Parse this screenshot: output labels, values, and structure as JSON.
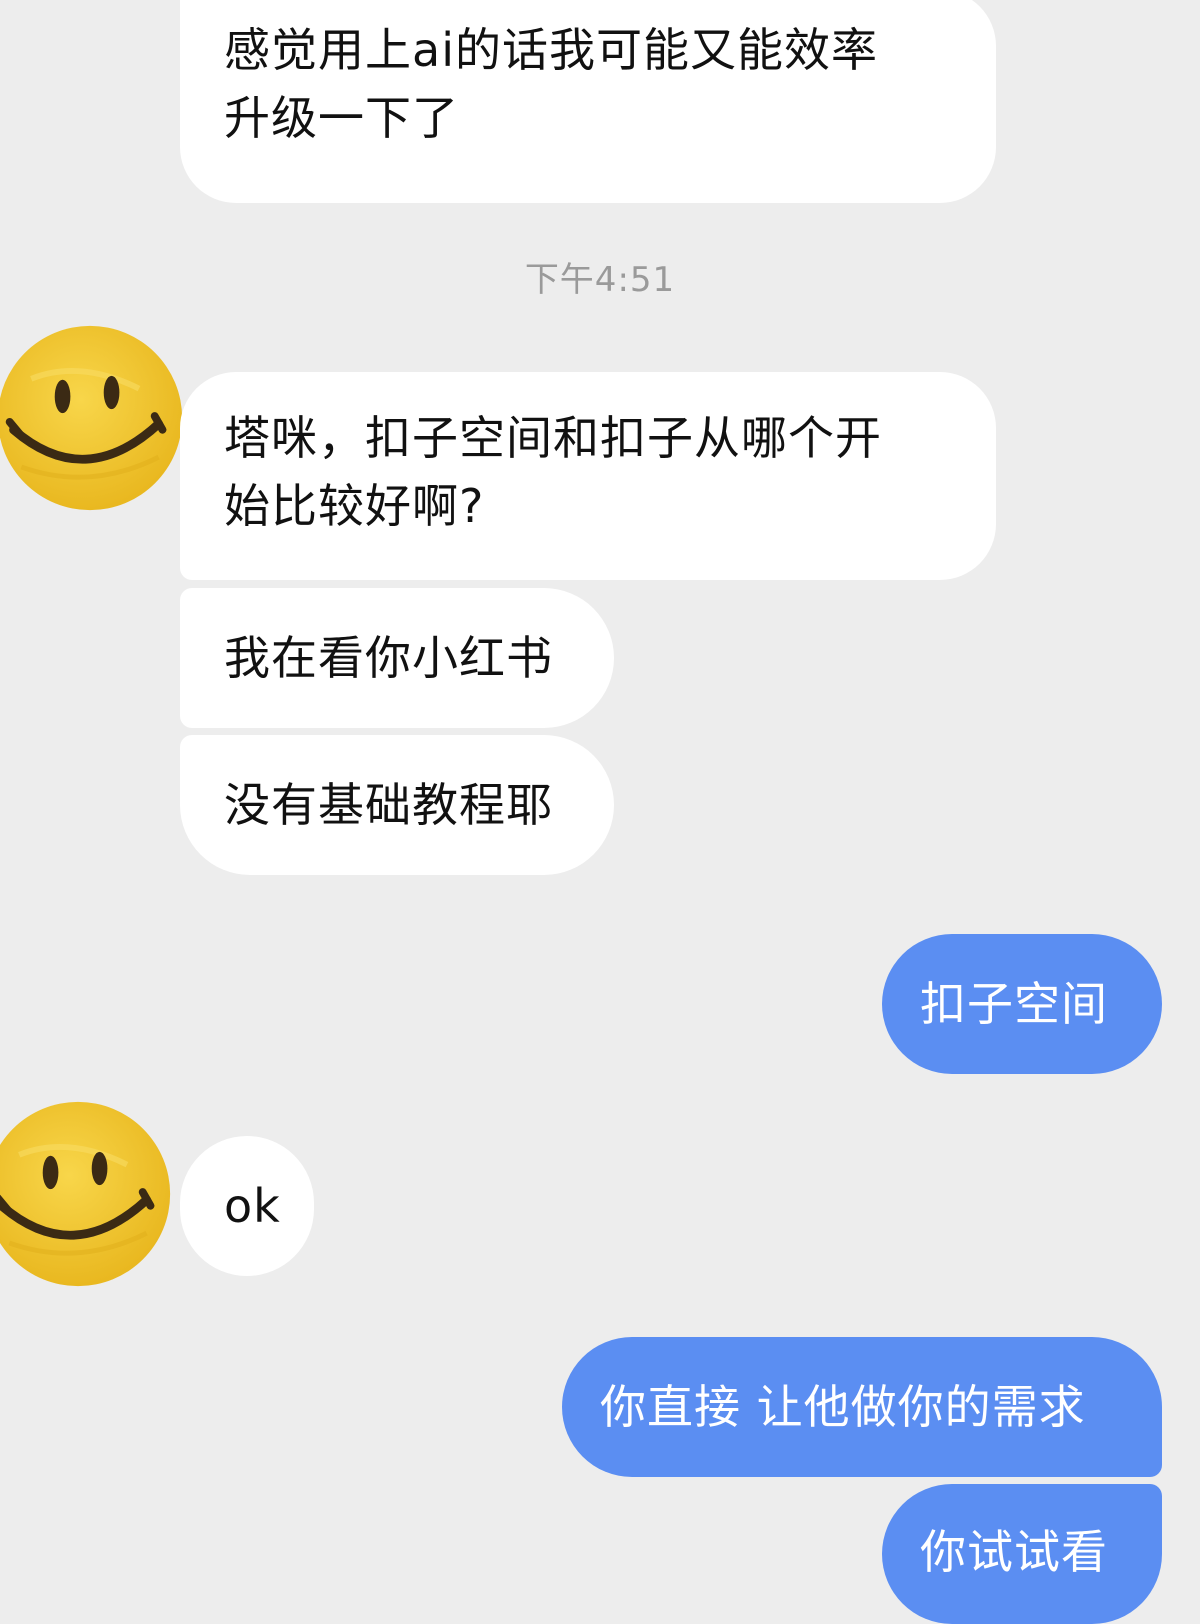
{
  "messages": [
    {
      "sender": "contact",
      "lines": [
        "感觉用上ai的话我可能又能效率",
        "升级一下了"
      ]
    },
    {
      "type": "timestamp",
      "text": "下午4:51"
    },
    {
      "sender": "contact",
      "avatar_icon": "smiley-face-icon",
      "lines": [
        "塔咪，扣子空间和扣子从哪个开",
        "始比较好啊?"
      ]
    },
    {
      "sender": "contact",
      "lines": [
        "我在看你小红书"
      ]
    },
    {
      "sender": "contact",
      "lines": [
        "没有基础教程耶"
      ]
    },
    {
      "sender": "me",
      "lines": [
        "扣子空间"
      ]
    },
    {
      "sender": "contact",
      "avatar_icon": "smiley-face-icon",
      "lines": [
        "ok"
      ]
    },
    {
      "sender": "me",
      "lines": [
        "你直接 让他做你的需求"
      ]
    },
    {
      "sender": "me",
      "lines": [
        "你试试看"
      ]
    }
  ],
  "colors": {
    "background": "#ededed",
    "incoming_bubble": "#ffffff",
    "outgoing_bubble": "#5b8ef2",
    "timestamp_text": "#9a9a9a",
    "avatar_yellow": "#f4c531"
  }
}
